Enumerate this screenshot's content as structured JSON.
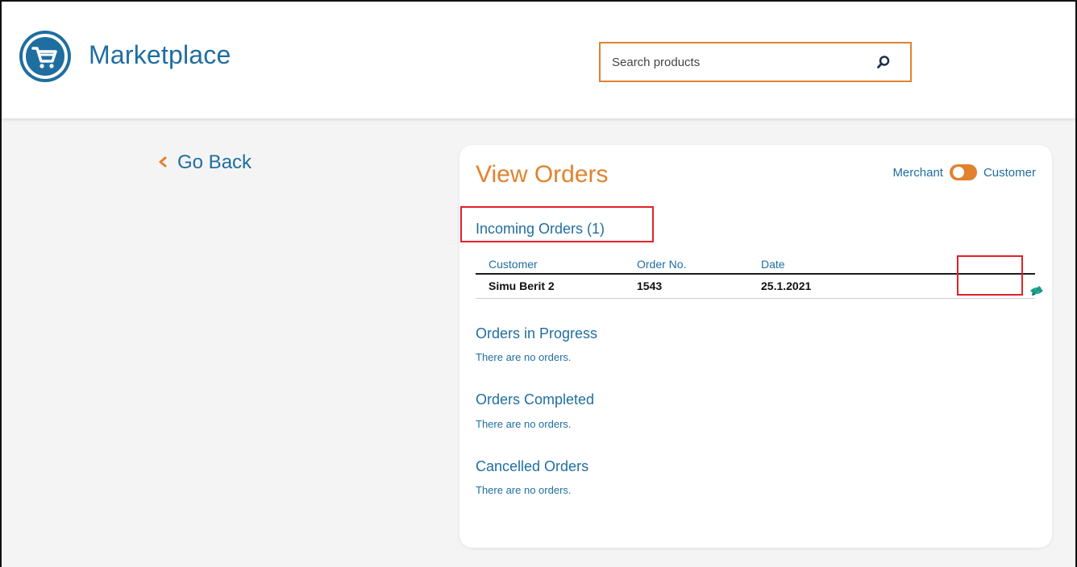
{
  "header": {
    "brand": "Marketplace",
    "search": {
      "placeholder": "Search products",
      "value": ""
    }
  },
  "nav": {
    "go_back": "Go Back",
    "back_icon": "chevron-left-icon"
  },
  "page": {
    "title": "View Orders",
    "toggle": {
      "left_label": "Merchant",
      "right_label": "Customer",
      "state": "Merchant"
    }
  },
  "sections": {
    "incoming": {
      "title": "Incoming Orders (1)",
      "columns": [
        "Customer",
        "Order No.",
        "Date"
      ],
      "rows": [
        {
          "customer": "Simu Berit 2",
          "order_no": "1543",
          "date": "25.1.2021"
        }
      ]
    },
    "in_progress": {
      "title": "Orders in Progress",
      "empty": "There are no orders."
    },
    "completed": {
      "title": "Orders Completed",
      "empty": "There are no orders."
    },
    "cancelled": {
      "title": "Cancelled Orders",
      "empty": "There are no orders."
    }
  },
  "colors": {
    "primary": "#1f6ea0",
    "accent": "#e0822e",
    "highlight": "#e3202a",
    "action": "#1a9a86"
  },
  "icons": [
    "shopping-cart-icon",
    "search-icon",
    "chevron-left-icon",
    "eye-icon",
    "pencil-icon"
  ]
}
